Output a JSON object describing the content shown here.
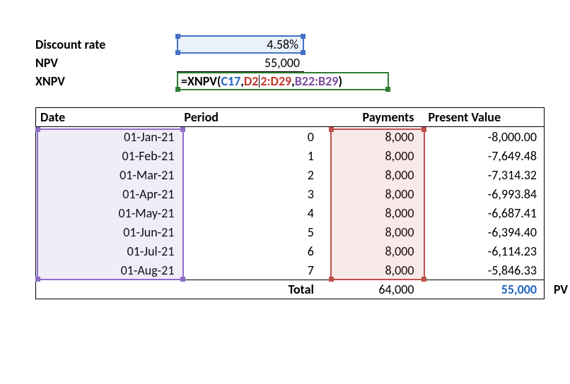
{
  "top": {
    "discount_label": "Discount rate",
    "discount_value": "4.58%",
    "npv_label": "NPV",
    "npv_value": "55,000",
    "xnpv_label": "XNPV"
  },
  "formula": {
    "eq": "=",
    "fn": "XNPV(",
    "ref1": "C17",
    "comma1": ",",
    "ref2a": "D2",
    "ref2b": "2:D29",
    "comma2": ",",
    "ref3": "B22:B29",
    "close": ")"
  },
  "headers": {
    "date": "Date",
    "period": "Period",
    "payments": "Payments",
    "pv": "Present Value"
  },
  "rows": [
    {
      "date": "01-Jan-21",
      "period": "0",
      "pay": "8,000",
      "pv": "-8,000.00"
    },
    {
      "date": "01-Feb-21",
      "period": "1",
      "pay": "8,000",
      "pv": "-7,649.48"
    },
    {
      "date": "01-Mar-21",
      "period": "2",
      "pay": "8,000",
      "pv": "-7,314.32"
    },
    {
      "date": "01-Apr-21",
      "period": "3",
      "pay": "8,000",
      "pv": "-6,993.84"
    },
    {
      "date": "01-May-21",
      "period": "4",
      "pay": "8,000",
      "pv": "-6,687.41"
    },
    {
      "date": "01-Jun-21",
      "period": "5",
      "pay": "8,000",
      "pv": "-6,394.40"
    },
    {
      "date": "01-Jul-21",
      "period": "6",
      "pay": "8,000",
      "pv": "-6,114.23"
    },
    {
      "date": "01-Aug-21",
      "period": "7",
      "pay": "8,000",
      "pv": "-5,846.33"
    }
  ],
  "totals": {
    "label": "Total",
    "pay": "64,000",
    "pv": "55,000",
    "pv_abbr": "PV"
  }
}
